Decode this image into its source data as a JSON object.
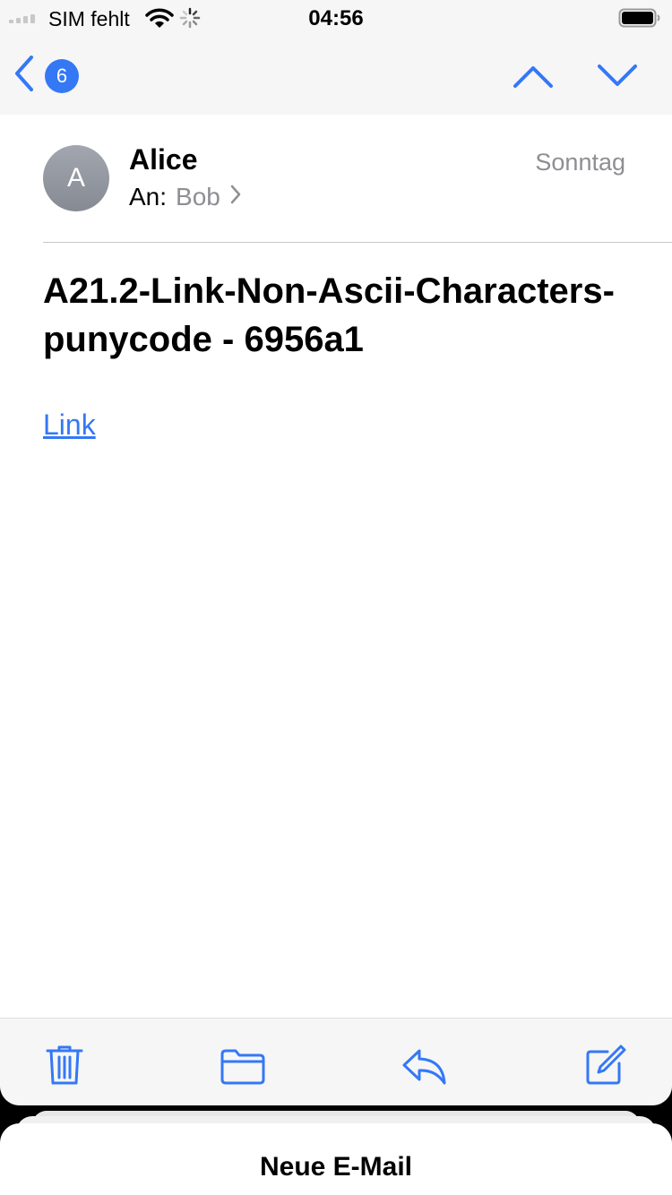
{
  "status_bar": {
    "carrier": "SIM fehlt",
    "time": "04:56",
    "icons": [
      "signal-icon",
      "wifi-icon",
      "activity-spinner-icon",
      "battery-icon"
    ]
  },
  "nav": {
    "back_icon": "chevron-left-icon",
    "unread_count": "6",
    "up_icon": "chevron-up-icon",
    "down_icon": "chevron-down-icon"
  },
  "message": {
    "avatar_initial": "A",
    "sender": "Alice",
    "date": "Sonntag",
    "to_label": "An:",
    "recipient": "Bob",
    "subject": "A21.2-Link-Non-Ascii-Characters-punycode - 6956a1",
    "link_text": "Link"
  },
  "toolbar": {
    "icons": [
      "trash-icon",
      "folder-icon",
      "reply-icon",
      "compose-icon"
    ]
  },
  "sheet": {
    "title": "Neue E-Mail"
  },
  "colors": {
    "accent": "#3478f6",
    "secondary_text": "#8e8e93",
    "bar_background": "#f6f6f6"
  }
}
